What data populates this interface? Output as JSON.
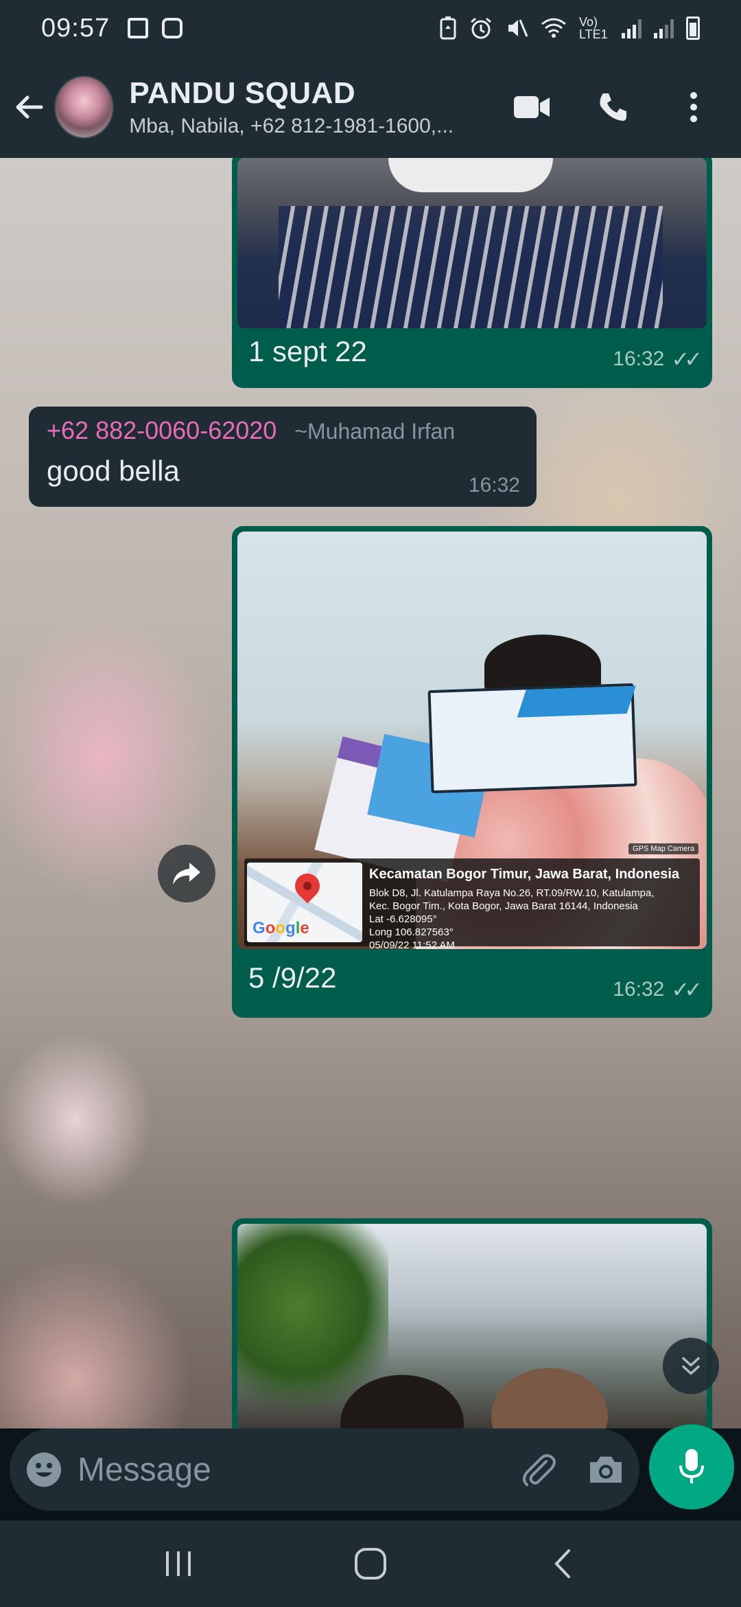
{
  "status_bar": {
    "time": "09:57",
    "network": "Vo) LTE1"
  },
  "header": {
    "group_name": "PANDU SQUAD",
    "members": "Mba, Nabila, +62 812-1981-1600,..."
  },
  "messages": [
    {
      "type": "image",
      "direction": "outgoing",
      "caption": "1 sept 22",
      "time": "16:32",
      "status": "read"
    },
    {
      "type": "text",
      "direction": "incoming",
      "sender_number": "+62 882-0060-62020",
      "sender_name": "~Muhamad Irfan",
      "text": "good bella",
      "time": "16:32",
      "sender_color": "#e86cb8"
    },
    {
      "type": "image",
      "direction": "outgoing",
      "caption": "5 /9/22",
      "time": "16:32",
      "status": "read",
      "gps_stamp": {
        "badge": "GPS Map Camera",
        "title": "Kecamatan Bogor Timur, Jawa Barat, Indonesia",
        "address1": "Blok D8, Jl. Katulampa Raya No.26, RT.09/RW.10, Katulampa,",
        "address2": "Kec. Bogor Tim., Kota Bogor, Jawa Barat 16144, Indonesia",
        "lat": "Lat -6.628095°",
        "long": "Long 106.827563°",
        "datetime": "05/09/22 11:52 AM",
        "map_brand": "Google"
      }
    },
    {
      "type": "image",
      "direction": "outgoing",
      "caption": "",
      "time": "",
      "status": ""
    }
  ],
  "input": {
    "placeholder": "Message"
  },
  "colors": {
    "header_bg": "#1f2c34",
    "outgoing_bubble": "#005c4b",
    "incoming_bubble": "#1f2c34",
    "accent": "#00a884"
  },
  "icons": {
    "back": "arrow-left-icon",
    "video": "video-call-icon",
    "phone": "voice-call-icon",
    "menu": "more-vert-icon",
    "forward": "forward-icon",
    "scroll_down": "double-chevron-down-icon",
    "emoji": "emoji-icon",
    "attach": "paperclip-icon",
    "camera": "camera-icon",
    "mic": "mic-icon"
  }
}
